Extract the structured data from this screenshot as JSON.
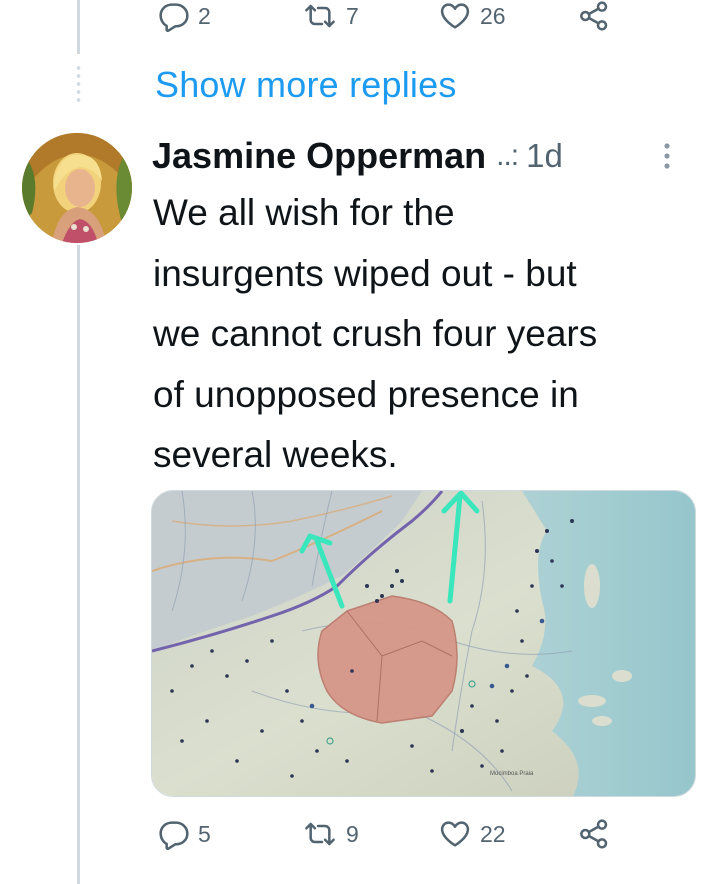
{
  "top_actions": {
    "replies": "2",
    "retweets": "7",
    "likes": "26",
    "reply_icon": "reply-icon",
    "retweet_icon": "retweet-icon",
    "like_icon": "heart-icon",
    "share_icon": "share-icon"
  },
  "show_more": "Show more replies",
  "tweet": {
    "author_name": "Jasmine Opperman",
    "handle_truncated": "..:",
    "time": "1d",
    "text": "We all wish for the\ninsurgents wiped out - but\nwe cannot crush four years\nof unopposed presence in\nseveral weeks.",
    "media_caption_text": "Mocimboa Praia"
  },
  "bottom_actions": {
    "replies": "5",
    "retweets": "9",
    "likes": "22"
  },
  "colors": {
    "accent": "#1d9bf0",
    "text": "#0f1419",
    "muted": "#536471",
    "thread_line": "#cfd9de",
    "map_arrow": "#2ee6b8"
  }
}
